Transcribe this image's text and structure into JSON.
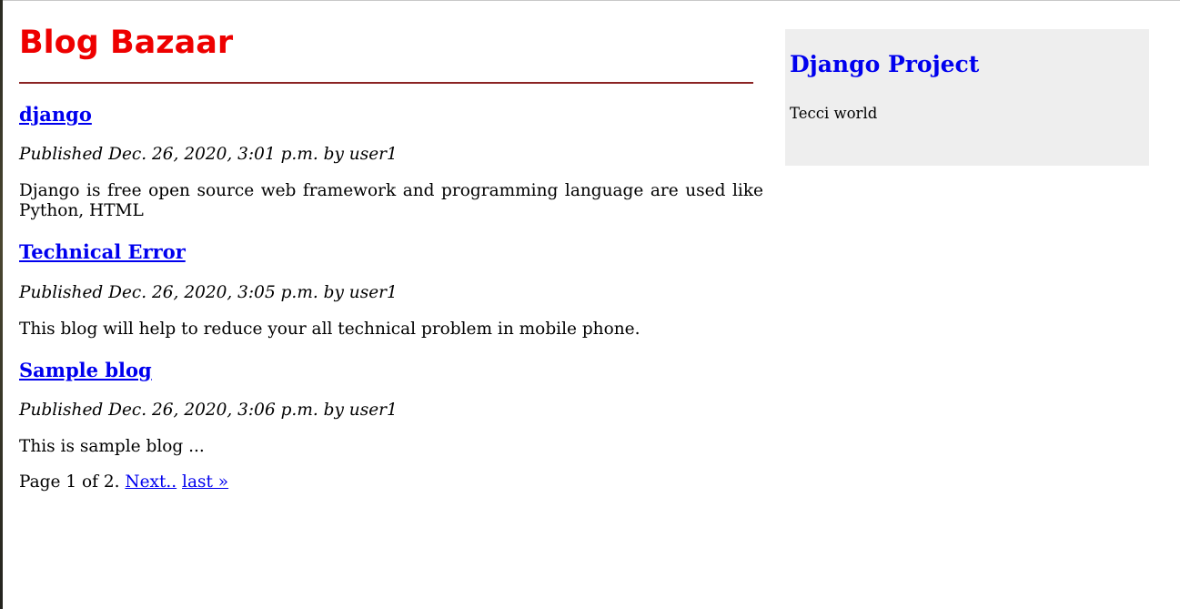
{
  "colors": {
    "title": "#ee0000",
    "link": "#0000ee",
    "rule": "#8b2323",
    "sidebar_bg": "#eeeeee"
  },
  "site": {
    "title": "Blog Bazaar"
  },
  "posts": [
    {
      "title": "django",
      "meta": "Published Dec. 26, 2020, 3:01 p.m. by user1",
      "body": "Django is free open source web framework and programming language are used like Python, HTML"
    },
    {
      "title": "Technical Error",
      "meta": "Published Dec. 26, 2020, 3:05 p.m. by user1",
      "body": "This blog will help to reduce your all technical problem in mobile phone."
    },
    {
      "title": "Sample blog",
      "meta": "Published Dec. 26, 2020, 3:06 p.m. by user1",
      "body": "This is sample blog ..."
    }
  ],
  "pagination": {
    "status": "Page 1 of 2.",
    "next_label": "Next..",
    "last_label": "last »"
  },
  "sidebar": {
    "title": "Django Project",
    "text": "Tecci world"
  }
}
